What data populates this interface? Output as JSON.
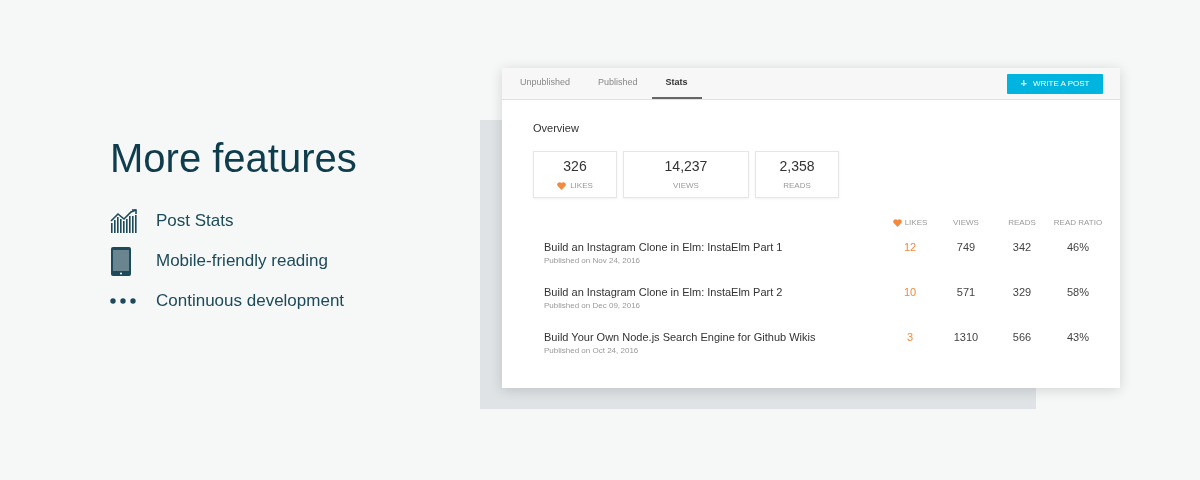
{
  "heading": "More features",
  "features": [
    {
      "kind": "chart",
      "label": "Post Stats"
    },
    {
      "kind": "tablet",
      "label": "Mobile-friendly reading"
    },
    {
      "kind": "dots",
      "label": "Continuous development"
    }
  ],
  "tabs": [
    {
      "label": "Unpublished",
      "selected": false
    },
    {
      "label": "Published",
      "selected": false
    },
    {
      "label": "Stats",
      "selected": true
    }
  ],
  "write_button": {
    "icon": "+",
    "label": "WRITE A POST"
  },
  "overview": {
    "title": "Overview",
    "stats": [
      {
        "kind": "likes",
        "value": "326",
        "label": "LIKES"
      },
      {
        "kind": "plain",
        "value": "14,237",
        "label": "VIEWS"
      },
      {
        "kind": "plain",
        "value": "2,358",
        "label": "READS"
      }
    ]
  },
  "table": {
    "columns": [
      {
        "kind": "likes",
        "label": "LIKES"
      },
      {
        "kind": "plain",
        "label": "VIEWS"
      },
      {
        "kind": "plain",
        "label": "READS"
      },
      {
        "kind": "plain",
        "label": "READ RATIO"
      }
    ],
    "rows": [
      {
        "title": "Build an Instagram Clone in Elm: InstaElm Part 1",
        "date": "Published on Nov 24, 2016",
        "likes": "12",
        "views": "749",
        "reads": "342",
        "ratio": "46%"
      },
      {
        "title": "Build an Instagram Clone in Elm: InstaElm Part 2",
        "date": "Published on Dec 09, 2016",
        "likes": "10",
        "views": "571",
        "reads": "329",
        "ratio": "58%"
      },
      {
        "title": "Build Your Own Node.js Search Engine for Github Wikis",
        "date": "Published on Oct 24, 2016",
        "likes": "3",
        "views": "1310",
        "reads": "566",
        "ratio": "43%"
      }
    ]
  }
}
